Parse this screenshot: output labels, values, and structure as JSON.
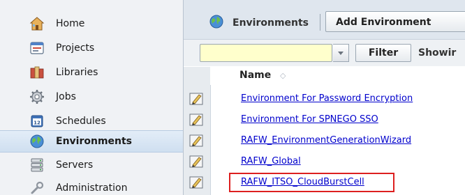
{
  "nav": {
    "items": [
      {
        "label": "Home",
        "icon": "home-icon",
        "selected": false
      },
      {
        "label": "Projects",
        "icon": "projects-icon",
        "selected": false
      },
      {
        "label": "Libraries",
        "icon": "libraries-icon",
        "selected": false
      },
      {
        "label": "Jobs",
        "icon": "jobs-gear-icon",
        "selected": false
      },
      {
        "label": "Schedules",
        "icon": "calendar-icon",
        "selected": false
      },
      {
        "label": "Environments",
        "icon": "globe-icon",
        "selected": true
      },
      {
        "label": "Servers",
        "icon": "server-icon",
        "selected": false
      },
      {
        "label": "Administration",
        "icon": "administration-icon",
        "selected": false
      }
    ],
    "calendar_day": "12"
  },
  "toolbar": {
    "title": "Environments",
    "add_label": "Add Environment"
  },
  "filter": {
    "value": "",
    "button_label": "Filter",
    "showing_text": "Showir"
  },
  "table": {
    "column_name": "Name",
    "sort_glyph": "◇",
    "rows": [
      {
        "name": "Environment For Password Encryption"
      },
      {
        "name": "Environment For SPNEGO SSO"
      },
      {
        "name": "RAFW_EnvironmentGenerationWizard"
      },
      {
        "name": "RAFW_Global"
      },
      {
        "name": "RAFW_ITSO_CloudBurstCell",
        "highlighted": true
      }
    ]
  },
  "colors": {
    "link": "#0000cc",
    "highlight_border": "#dd1f1f",
    "filter_bg": "#ffffcc",
    "nav_bg": "#f0f2f5",
    "selected_bg": "#d6e4f3"
  }
}
